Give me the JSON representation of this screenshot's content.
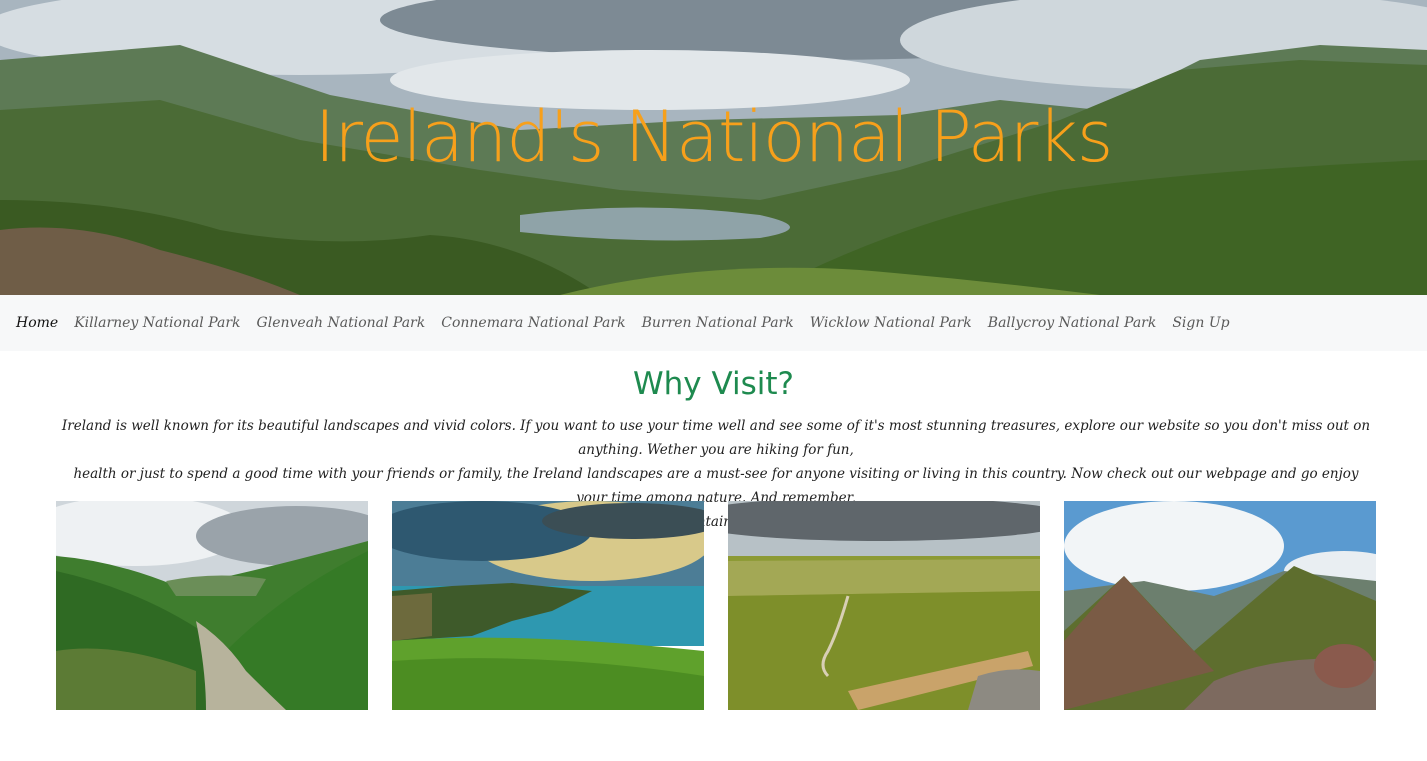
{
  "hero": {
    "title": "Ireland's National Parks",
    "image": "mountain-lake-valley-landscape",
    "title_color": "#f7a01b"
  },
  "nav": {
    "items": [
      {
        "label": "Home",
        "active": true
      },
      {
        "label": "Killarney National Park"
      },
      {
        "label": "Glenveah National Park"
      },
      {
        "label": "Connemara National Park"
      },
      {
        "label": "Burren National Park"
      },
      {
        "label": "Wicklow National Park"
      },
      {
        "label": "Ballycroy National Park"
      },
      {
        "label": "Sign Up"
      }
    ]
  },
  "main": {
    "title": "Why Visit?",
    "title_color": "#1e8a4f",
    "intro_lines": [
      "Ireland is well known for its beautiful landscapes and vivid colors.  If you want to use your time well and see some of it's most stunning treasures, explore our website so you don't miss out on anything. Wether you are hiking for fun,",
      "health or just to spend a good time with your friends or family, the Ireland landscapes are a must-see for anyone visiting or living in this country. Now check out our webpage and go enjoy your time among nature. And remember,",
      "respect the mountains, and keep safe."
    ]
  },
  "gallery": {
    "images": [
      {
        "subject": "green-valley-with-river"
      },
      {
        "subject": "sea-cliffs-at-sunset"
      },
      {
        "subject": "boardwalk-through-bogland"
      },
      {
        "subject": "rocky-mountain-ridge"
      }
    ]
  }
}
